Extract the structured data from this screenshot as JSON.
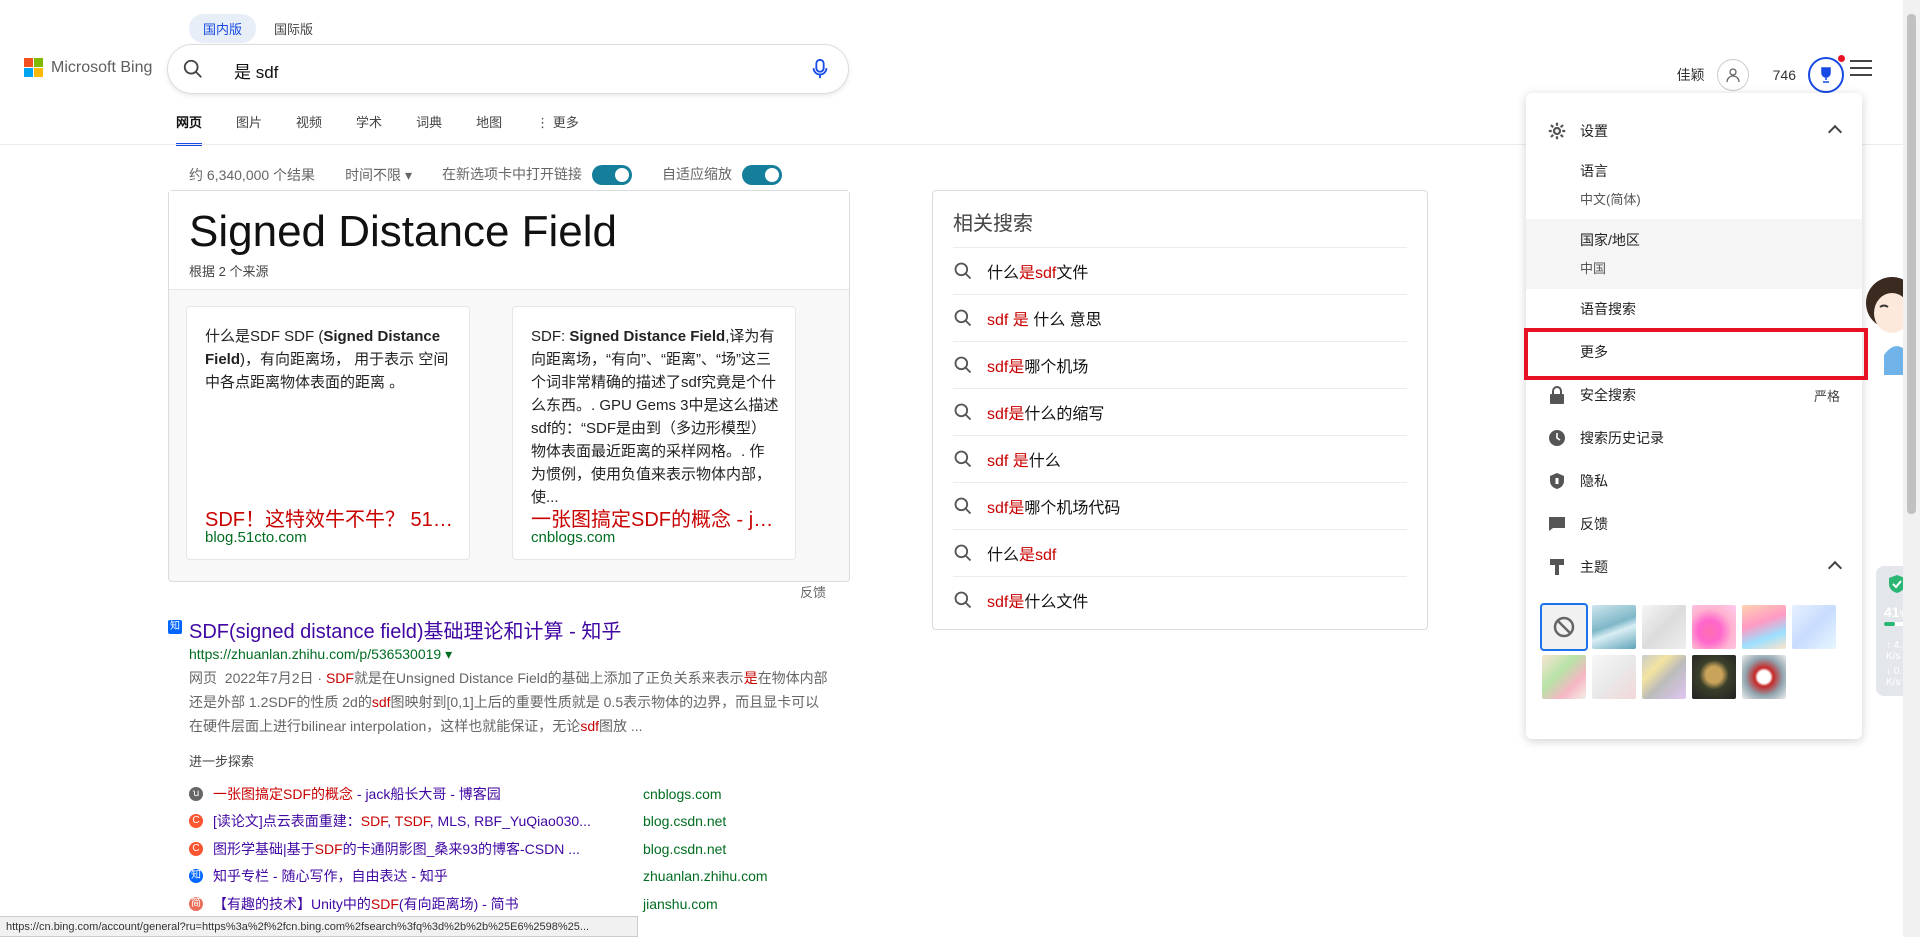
{
  "region_tabs": [
    "国内版",
    "国际版"
  ],
  "logo": {
    "text": "Microsoft Bing",
    "colors": [
      "#f25022",
      "#7fba00",
      "#00a4ef",
      "#ffb900"
    ]
  },
  "search": {
    "value": "是 sdf"
  },
  "nav": [
    "网页",
    "图片",
    "视频",
    "学术",
    "词典",
    "地图",
    "⋮ 更多"
  ],
  "header": {
    "user_name": "佳颖",
    "points": "746"
  },
  "filters": {
    "count": "约 6,340,000 个结果",
    "time": "时间不限 ▾",
    "new_tab": "在新选项卡中打开链接",
    "adaptive": "自适应缩放"
  },
  "answer": {
    "title": "Signed Distance Field",
    "subtitle": "根据 2 个来源",
    "cards": [
      {
        "text_html": "什么是SDF SDF (<b>Signed Distance Field</b>)，有向距离场， 用于表示 空间中各点距离物体表面的距离 。",
        "link": "SDF！这特效牛不牛？ 51C...",
        "domain": "blog.51cto.com"
      },
      {
        "text_html": "SDF: <b>Signed Distance Field</b>,译为有向距离场，“有向”、“距离”、“场”这三个词非常精确的描述了sdf究竟是个什么东西。. GPU Gems 3中是这么描述sdf的：“SDF是由到（多边形模型）物体表面最近距离的采样网格。. 作为惯例，使用负值来表示物体内部，使...",
        "link": "一张图搞定SDF的概念 - jac...",
        "domain": "cnblogs.com"
      }
    ],
    "feedback": "反馈"
  },
  "result": {
    "favicon": "知",
    "title": "SDF(signed distance field)基础理论和计算 - 知乎",
    "url": "https://zhuanlan.zhihu.com/p/536530019 ▾",
    "snippet_html": "网页 &nbsp;2022年7月2日 · <span class='hl'>SDF</span>就是在Unsigned Distance Field的基础上添加了正负关系来表示<span class='hl'>是</span>在物体内部还是外部 1.2SDF的性质 2d的<span class='hl'>sdf</span>图映射到[0,1]上后的重要性质就是 0.5表示物体的边界，而且显卡可以在硬件层面上进行bilinear interpolation，这样也就能保证，无论<span class='hl'>sdf</span>图放 ..."
  },
  "more_explore": "进一步探索",
  "explore": [
    {
      "icon": "ꭒ",
      "color": "#666",
      "title_html": "<span class='hl'>一张图搞定SDF的概念</span> - jack船长大哥 - 博客园",
      "domain": "cnblogs.com"
    },
    {
      "icon": "C",
      "color": "#fc5531",
      "title_html": "[读论文]点云表面重建：<span class='hl'>SDF</span>, <span class='hl'>TSDF</span>, MLS, RBF_YuQiao030...",
      "domain": "blog.csdn.net"
    },
    {
      "icon": "C",
      "color": "#fc5531",
      "title_html": "图形学基础|基于<span class='hl'>SDF</span>的卡通阴影图_桑来93的博客-CSDN ...",
      "domain": "blog.csdn.net"
    },
    {
      "icon": "知",
      "color": "#0066ff",
      "title_html": "知乎专栏 - 随心写作，自由表达 - 知乎",
      "domain": "zhuanlan.zhihu.com"
    },
    {
      "icon": "简",
      "color": "#ea6f5a",
      "title_html": "【有趣的技术】Unity中的<span class='hl'>SDF</span>(有向距离场) - 简书",
      "domain": "jianshu.com"
    }
  ],
  "related": {
    "title": "相关搜索",
    "items_html": [
      "什么<span class='hl'>是sdf</span>文件",
      "<span class='hl'>sdf 是</span> 什么 意思",
      "<span class='hl'>sdf是</span>哪个机场",
      "<span class='hl'>sdf是</span>什么的缩写",
      "<span class='hl'>sdf 是</span>什么",
      "<span class='hl'>sdf是</span>哪个机场代码",
      "什么<span class='hl'>是sdf</span>",
      "<span class='hl'>sdf是</span>什么文件"
    ]
  },
  "settings": {
    "header": "设置",
    "language_label": "语言",
    "language_value": "中文(简体)",
    "region_label": "国家/地区",
    "region_value": "中国",
    "voice_search": "语音搜索",
    "more": "更多",
    "safe_search": "安全搜索",
    "safe_search_value": "严格",
    "history": "搜索历史记录",
    "privacy": "隐私",
    "feedback": "反馈",
    "theme": "主题"
  },
  "status_bar": "https://cn.bing.com/account/general?ru=https%3a%2f%2fcn.bing.com%2fsearch%3fq%3d%2b%2b%25E6%2598%25...",
  "widget": {
    "percent": "41",
    "pct_unit": "%",
    "up": "4.2",
    "down": "0.1",
    "unit": "K/s"
  }
}
